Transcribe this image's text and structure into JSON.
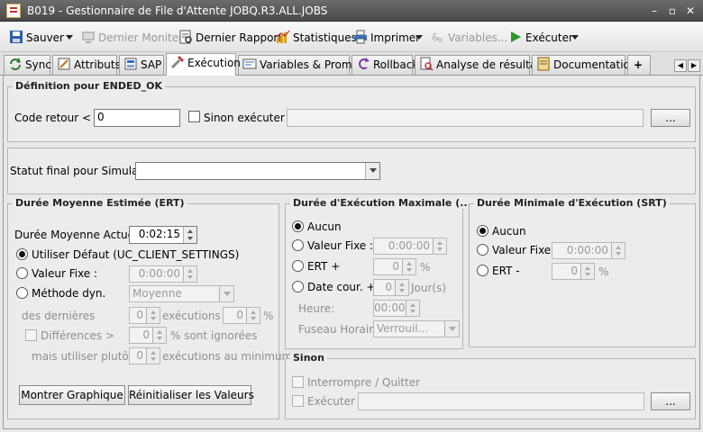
{
  "window": {
    "title": "B019 - Gestionnaire de File d'Attente JOBQ.R3.ALL.JOBS",
    "minimize": "–",
    "restore": "▫",
    "close": "✕"
  },
  "toolbar": {
    "save": "Sauver",
    "last_monitor": "Dernier Moniteur",
    "last_report": "Dernier Rapport",
    "statistics": "Statistiques",
    "print": "Imprimer",
    "variables": "Variables...",
    "execute": "Exécuter"
  },
  "tabs": [
    "Sync",
    "Attributs",
    "SAP",
    "Exécution",
    "Variables & Prompts",
    "Rollback",
    "Analyse de résultats",
    "Documentation",
    "+"
  ],
  "active_tab": "Exécution",
  "ended_ok": {
    "legend": "Définition pour ENDED_OK",
    "return_code_label": "Code retour < =:",
    "return_code_value": "0",
    "else_execute_label": "Sinon exécuter :",
    "else_execute_value": "",
    "browse_label": "..."
  },
  "simulation": {
    "label": "Statut final pour Simulation:",
    "value": ""
  },
  "ert": {
    "legend": "Durée Moyenne Estimée (ERT)",
    "current_label": "Durée Moyenne Actuelle:",
    "current_value": "0:02:15",
    "use_default_label": "Utiliser Défaut (UC_CLIENT_SETTINGS)",
    "fixed_value_label": "Valeur Fixe :",
    "fixed_value": "0:00:00",
    "dyn_method_label": "Méthode dyn.",
    "dyn_method_value": "Moyenne",
    "last_label": "des dernières",
    "last_value": "0",
    "executions_plus": "exécutions +",
    "percent_value": "0",
    "percent": "%",
    "differences_label": "Différences >",
    "diff_value": "0",
    "ignored_label": "% sont ignorées",
    "but_use_label": "mais utiliser plutôt:",
    "but_use_value": "0",
    "min_executions_label": "exécutions au minimum",
    "show_graph": "Montrer Graphique",
    "reset_values": "Réinitialiser les Valeurs"
  },
  "max_duration": {
    "legend": "Durée d'Exécution Maximale (...",
    "none_label": "Aucun",
    "fixed_label": "Valeur Fixe :",
    "fixed_value": "0:00:00",
    "ert_plus_label": "ERT +",
    "ert_value": "0",
    "percent": "%",
    "current_date_label": "Date cour. +",
    "days_value": "0",
    "days_label": "Jour(s)",
    "time_label": "Heure:",
    "time_value": "00:00",
    "timezone_label": "Fuseau Horaire:",
    "timezone_value": "Verrouil..."
  },
  "min_duration": {
    "legend": "Durée Minimale d'Exécution (SRT)",
    "none_label": "Aucun",
    "fixed_label": "Valeur Fixe :",
    "fixed_value": "0:00:00",
    "ert_minus_label": "ERT -",
    "ert_value": "0",
    "percent": "%"
  },
  "else": {
    "legend": "Sinon",
    "interrupt_label": "Interrompre / Quitter",
    "execute_label": "Exécuter",
    "execute_value": "",
    "browse_label": "..."
  }
}
